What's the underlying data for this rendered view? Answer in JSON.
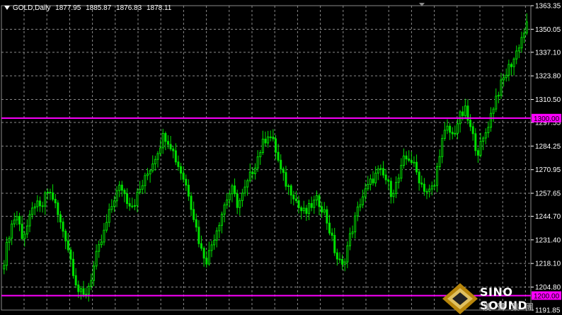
{
  "header": {
    "symbol": "GOLD,Daily",
    "open": "1877.95",
    "high": "1885.87",
    "low": "1876.83",
    "close": "1878.11"
  },
  "colors": {
    "background": "#000000",
    "grid": "#8a8a8a",
    "candle": "#00e000",
    "level_line": "#ff00ff",
    "axis_text": "#ffffff"
  },
  "chart_data": {
    "type": "candlestick",
    "ylim": [
      1191.85,
      1363.35
    ],
    "ytick_labels": [
      "1363.35",
      "1350.05",
      "1337.10",
      "1323.80",
      "1310.50",
      "1297.55",
      "1284.25",
      "1270.95",
      "1257.65",
      "1244.70",
      "1231.40",
      "1218.10",
      "1204.80",
      "1191.85"
    ],
    "horizontal_levels": [
      {
        "value": 1300.0,
        "label": "1300.00"
      },
      {
        "value": 1200.0,
        "label": "1200.00"
      }
    ],
    "grid": true,
    "close_path": [
      1220,
      1238,
      1246,
      1233,
      1241,
      1252,
      1248,
      1259,
      1255,
      1242,
      1233,
      1218,
      1203,
      1199,
      1208,
      1222,
      1232,
      1245,
      1256,
      1262,
      1254,
      1251,
      1259,
      1266,
      1274,
      1282,
      1291,
      1286,
      1276,
      1268,
      1258,
      1242,
      1226,
      1220,
      1232,
      1242,
      1253,
      1260,
      1251,
      1258,
      1267,
      1276,
      1285,
      1292,
      1284,
      1270,
      1262,
      1258,
      1249,
      1246,
      1251,
      1254,
      1248,
      1236,
      1222,
      1216,
      1230,
      1242,
      1254,
      1260,
      1266,
      1270,
      1266,
      1258,
      1264,
      1276,
      1278,
      1270,
      1262,
      1258,
      1262,
      1285,
      1294,
      1290,
      1300,
      1304,
      1292,
      1281,
      1288,
      1300,
      1312,
      1320,
      1328,
      1334,
      1344,
      1352
    ]
  },
  "watermark": {
    "brand": "SINO SOUND",
    "chinese": "漢聲集團"
  }
}
